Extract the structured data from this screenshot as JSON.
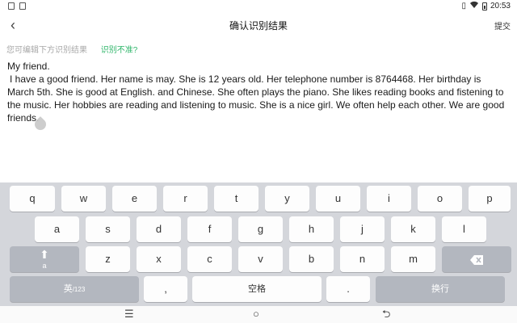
{
  "status_bar": {
    "time": "20:53"
  },
  "header": {
    "back_icon": "‹",
    "title": "确认识别结果",
    "submit_label": "提交"
  },
  "hint": {
    "text": "您可编辑下方识别结果",
    "link": "识别不准?"
  },
  "content": {
    "line1": "My friend.",
    "body": "I have a good friend. Her name is may. She is 12 years old. Her telephone number is 8764468. Her birthday is March 5th. She is good at English. and Chinese. She often plays the piano. She likes reading books and fistening to the music. Her hobbies are reading and listening to music. She is a nice girl. We often help each other. We are good friends."
  },
  "keyboard": {
    "row1": [
      "q",
      "w",
      "e",
      "r",
      "t",
      "y",
      "u",
      "i",
      "o",
      "p"
    ],
    "row2": [
      "a",
      "s",
      "d",
      "f",
      "g",
      "h",
      "j",
      "k",
      "l"
    ],
    "row3": [
      "z",
      "x",
      "c",
      "v",
      "b",
      "n",
      "m"
    ],
    "shift_label": "a",
    "lang_label": "英",
    "lang_sub": "/123",
    "comma": ",",
    "space": "空格",
    "period": ".",
    "enter": "换行"
  },
  "nav": {
    "menu": "☰",
    "home": "○",
    "back": "⮌"
  }
}
